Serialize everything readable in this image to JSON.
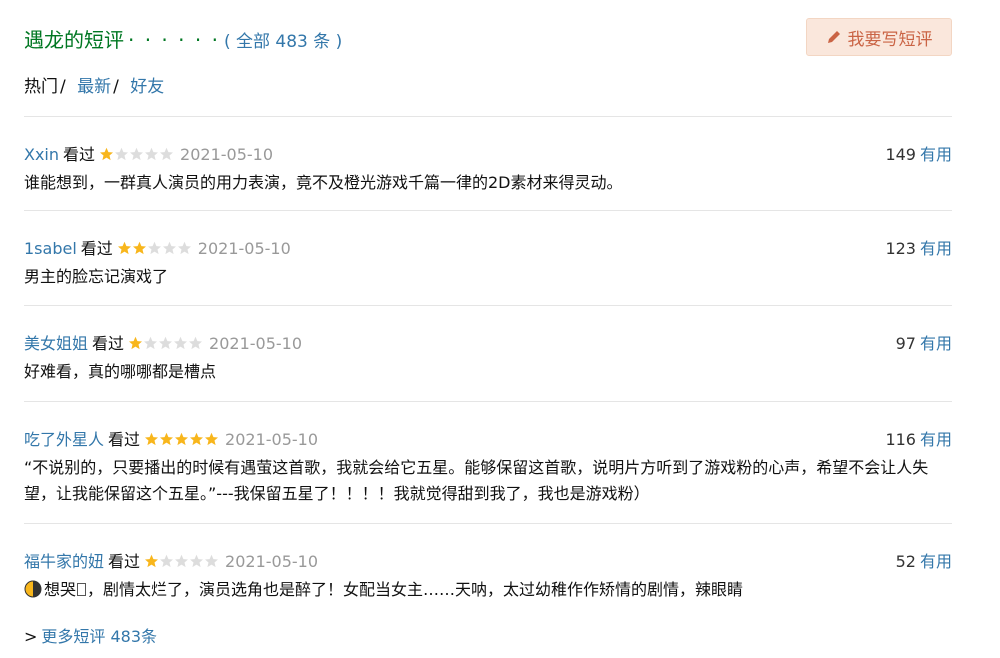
{
  "header": {
    "title": "遇龙的短评",
    "dots": "· · · · · ·",
    "count_prefix": "(",
    "count_link": "全部 483 条",
    "count_suffix": ")",
    "write_button": "我要写短评"
  },
  "tabs": {
    "hot": "热门",
    "latest": "最新",
    "friends": "好友",
    "sep": "/"
  },
  "colors": {
    "title_green": "#007722",
    "link_blue": "#3377aa",
    "star_gold": "#f8b61c",
    "star_gray": "#dddddd",
    "button_bg": "#fae7dc",
    "button_text": "#ca6445"
  },
  "comments": [
    {
      "user": "Xxin",
      "status": "看过",
      "rating": 1,
      "date": "2021-05-10",
      "votes": "149",
      "useful": "有用",
      "content": "谁能想到，一群真人演员的用力表演，竟不及橙光游戏千篇一律的2D素材来得灵动。"
    },
    {
      "user": "1sabel",
      "status": "看过",
      "rating": 2,
      "date": "2021-05-10",
      "votes": "123",
      "useful": "有用",
      "content": "男主的脸忘记演戏了"
    },
    {
      "user": "美女姐姐",
      "status": "看过",
      "rating": 1,
      "date": "2021-05-10",
      "votes": "97",
      "useful": "有用",
      "content": "好难看，真的哪哪都是槽点"
    },
    {
      "user": "吃了外星人",
      "status": "看过",
      "rating": 5,
      "date": "2021-05-10",
      "votes": "116",
      "useful": "有用",
      "content": "“不说别的，只要播出的时候有遇萤这首歌，我就会给它五星。能够保留这首歌，说明片方听到了游戏粉的心声，希望不会让人失望，让我能保留这个五星。”---我保留五星了！！！！我就觉得甜到我了，我也是游戏粉）"
    },
    {
      "user": "福牛家的妞",
      "status": "看过",
      "rating": 1,
      "date": "2021-05-10",
      "votes": "52",
      "useful": "有用",
      "content_prefix": "想哭",
      "content": "，剧情太烂了，演员选角也是醉了！女配当女主……天呐，太过幼稚作作矫情的剧情，辣眼睛"
    }
  ],
  "footer": {
    "arrow": ">",
    "more_link": "更多短评 483条"
  }
}
